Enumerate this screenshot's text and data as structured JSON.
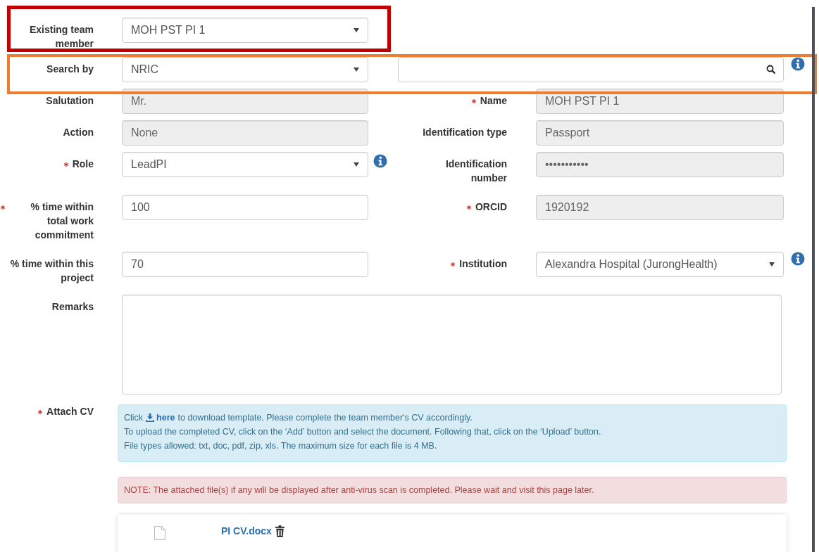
{
  "form": {
    "rows": [
      {
        "left": {
          "label": "Existing team member",
          "kind": "select",
          "value": "MOH PST PI 1",
          "required": false,
          "disabled": false
        }
      },
      {
        "left": {
          "label": "Search by",
          "kind": "select",
          "value": "NRIC",
          "required": false,
          "disabled": false
        },
        "right": {
          "kind": "search",
          "disabled": false,
          "info": true
        }
      },
      {
        "left": {
          "label": "Salutation",
          "kind": "text",
          "value": "Mr.",
          "required": false,
          "disabled": true
        },
        "right": {
          "label": "Name",
          "kind": "text",
          "value": "MOH PST PI 1",
          "required": true,
          "disabled": true
        }
      },
      {
        "left": {
          "label": "Action",
          "kind": "text",
          "value": "None",
          "required": false,
          "disabled": true
        },
        "right": {
          "label": "Identification type",
          "kind": "text",
          "value": "Passport",
          "required": false,
          "disabled": true
        }
      },
      {
        "left": {
          "label": "Role",
          "kind": "select",
          "value": "LeadPI",
          "required": true,
          "disabled": false,
          "info": true
        },
        "right": {
          "label": "Identification number",
          "kind": "text",
          "value": "•••••••••••",
          "required": false,
          "disabled": true
        }
      },
      {
        "left": {
          "label": "% time within total work commitment",
          "kind": "text",
          "value": "100",
          "required": true,
          "disabled": false
        },
        "right": {
          "label": "ORCID",
          "kind": "text",
          "value": "1920192",
          "required": true,
          "disabled": true
        }
      },
      {
        "left": {
          "label": "% time within this project",
          "kind": "text",
          "value": "70",
          "required": false,
          "disabled": false
        },
        "right": {
          "label": "Institution",
          "kind": "select",
          "value": "Alexandra Hospital (JurongHealth)",
          "required": true,
          "disabled": false,
          "info": true
        }
      },
      {
        "left": {
          "label": "Remarks",
          "kind": "textarea",
          "required": false,
          "disabled": false
        }
      }
    ],
    "attach": {
      "label": "Attach CV",
      "required": true,
      "download": {
        "before": "Click",
        "link": "here",
        "after": "to download template. Please complete the team member's CV accordingly."
      },
      "lines": [
        "To upload the completed CV, click on the ‘Add’ button and select the document. Following that, click on the ‘Upload’ button.",
        "File types allowed: txt, doc, pdf, zip, xls. The maximum size for each file is 4 MB."
      ],
      "note": "NOTE: The attached file(s) if any will be displayed after anti-virus scan is completed. Please wait and visit this page later.",
      "files": [
        {
          "name": "PI CV.docx"
        }
      ]
    }
  }
}
